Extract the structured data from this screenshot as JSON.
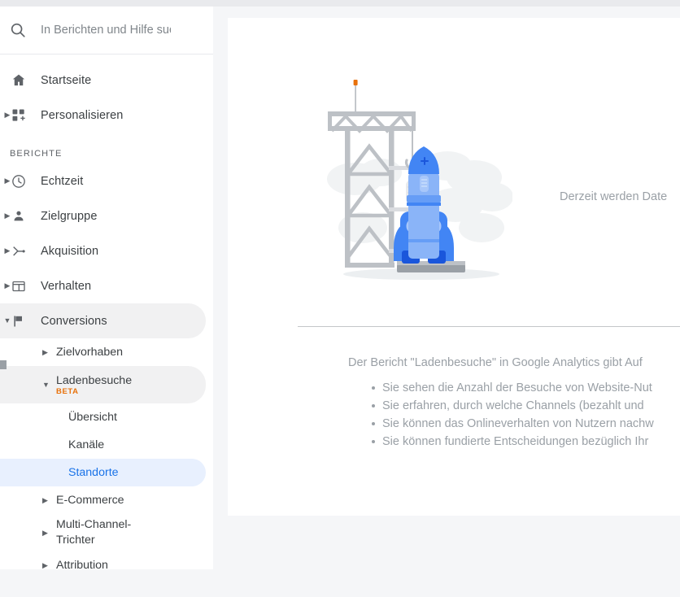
{
  "search": {
    "placeholder": "In Berichten und Hilfe such",
    "value": "",
    "icon": "search-icon"
  },
  "sidebar": {
    "top_items": [
      {
        "label": "Startseite",
        "icon": "home-icon",
        "expandable": false
      },
      {
        "label": "Personalisieren",
        "icon": "customization-icon",
        "expandable": true
      }
    ],
    "section_label": "BERICHTE",
    "report_items": [
      {
        "label": "Echtzeit",
        "icon": "clock-icon",
        "expandable": true,
        "active": false
      },
      {
        "label": "Zielgruppe",
        "icon": "person-icon",
        "expandable": true,
        "active": false
      },
      {
        "label": "Akquisition",
        "icon": "acquisition-icon",
        "expandable": true,
        "active": false
      },
      {
        "label": "Verhalten",
        "icon": "behavior-icon",
        "expandable": true,
        "active": false
      },
      {
        "label": "Conversions",
        "icon": "flag-icon",
        "expandable": true,
        "active": true
      }
    ],
    "conversions_children": [
      {
        "label": "Zielvorhaben",
        "expandable": true,
        "expanded": false,
        "badge": ""
      },
      {
        "label": "Ladenbesuche",
        "expandable": true,
        "expanded": true,
        "badge": "BETA"
      }
    ],
    "ladenbesuche_children": [
      {
        "label": "Übersicht",
        "selected": false
      },
      {
        "label": "Kanäle",
        "selected": false
      },
      {
        "label": "Standorte",
        "selected": true
      }
    ],
    "conversions_children_after": [
      {
        "label": "E-Commerce",
        "expandable": true
      },
      {
        "label": "Multi-Channel-Trichter",
        "expandable": true
      },
      {
        "label": "Attribution",
        "expandable": true
      }
    ]
  },
  "content": {
    "hero_text": "Derzeit werden Date",
    "intro": "Der Bericht \"Ladenbesuche\" in Google Analytics gibt Auf",
    "bullets": [
      "Sie sehen die Anzahl der Besuche von Website-Nut",
      "Sie erfahren, durch welche Channels (bezahlt und",
      "Sie können das Onlineverhalten von Nutzern nachw",
      "Sie können fundierte Entscheidungen bezüglich Ihr"
    ]
  },
  "colors": {
    "accent_blue": "#1a73e8",
    "selected_bg": "#e8f0fe",
    "beta_orange": "#e8710a",
    "text_primary": "#3c4043",
    "text_muted": "#9aa0a6",
    "panel_bg": "#ffffff",
    "page_bg": "#f5f6f8"
  }
}
